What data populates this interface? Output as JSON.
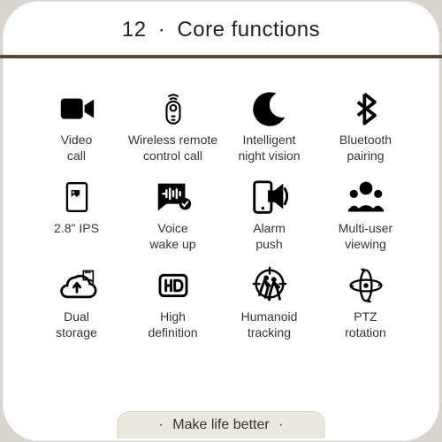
{
  "header": {
    "number": "12",
    "separator": "·",
    "title": "Core functions"
  },
  "features": [
    {
      "icon": "video-call-icon",
      "label": "Video\ncall"
    },
    {
      "icon": "wireless-remote-icon",
      "label": "Wireless remote\ncontrol call"
    },
    {
      "icon": "night-vision-icon",
      "label": "Intelligent\nnight vision"
    },
    {
      "icon": "bluetooth-icon",
      "label": "Bluetooth\npairing"
    },
    {
      "icon": "ips-screen-icon",
      "label": "2.8\" IPS"
    },
    {
      "icon": "voice-wakeup-icon",
      "label": "Voice\nwake up"
    },
    {
      "icon": "alarm-push-icon",
      "label": "Alarm\npush"
    },
    {
      "icon": "multi-user-icon",
      "label": "Multi-user\nviewing"
    },
    {
      "icon": "dual-storage-icon",
      "label": "Dual\nstorage"
    },
    {
      "icon": "hd-icon",
      "label": "High\ndefinition"
    },
    {
      "icon": "humanoid-tracking-icon",
      "label": "Humanoid\ntracking"
    },
    {
      "icon": "ptz-rotation-icon",
      "label": "PTZ\nrotation"
    }
  ],
  "footer": {
    "separator": "·",
    "text": "Make life better"
  }
}
